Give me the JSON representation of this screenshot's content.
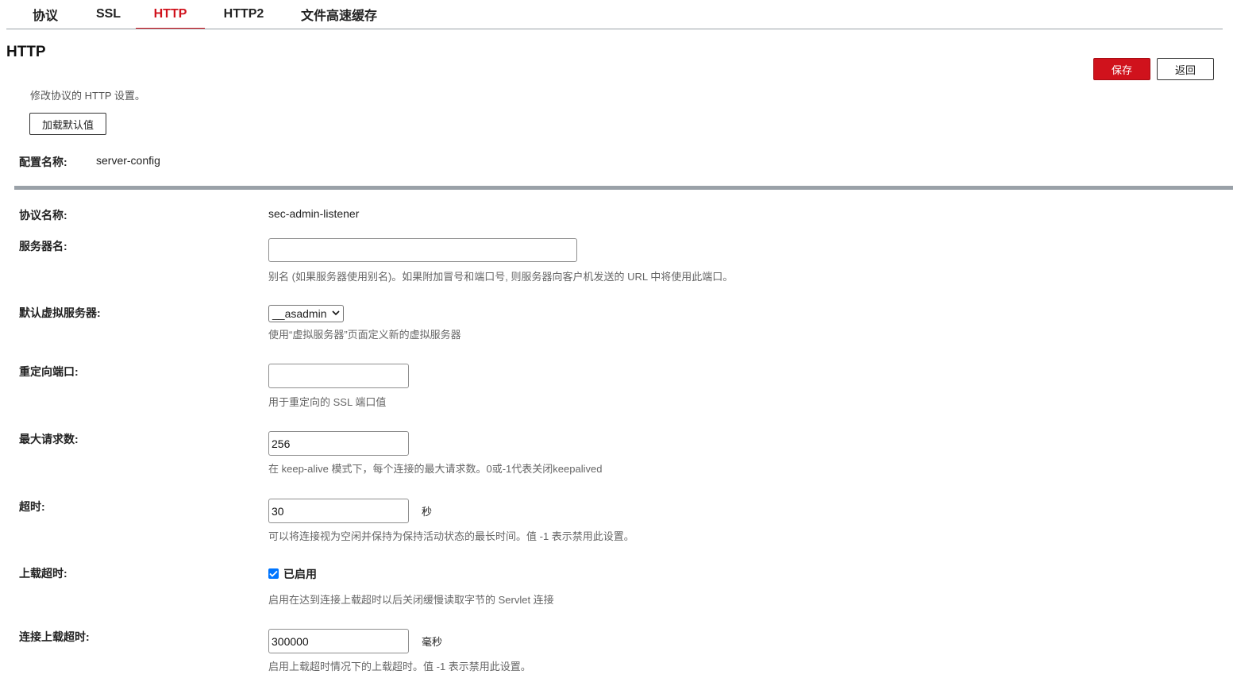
{
  "tabs": [
    {
      "label": "协议"
    },
    {
      "label": "SSL"
    },
    {
      "label": "HTTP"
    },
    {
      "label": "HTTP2"
    },
    {
      "label": "文件高速缓存"
    }
  ],
  "active_tab": "HTTP",
  "page": {
    "title": "HTTP",
    "description": "修改协议的 HTTP 设置。",
    "load_defaults_label": "加载默认值",
    "save_label": "保存",
    "back_label": "返回"
  },
  "config": {
    "label": "配置名称:",
    "value": "server-config"
  },
  "fields": {
    "protocol_name": {
      "label": "协议名称:",
      "value": "sec-admin-listener"
    },
    "server_name": {
      "label": "服务器名:",
      "value": "",
      "help": "别名 (如果服务器使用别名)。如果附加冒号和端口号, 则服务器向客户机发送的 URL 中将使用此端口。"
    },
    "default_virtual_server": {
      "label": "默认虚拟服务器:",
      "selected": "__asadmin",
      "help": "使用“虚拟服务器”页面定义新的虚拟服务器"
    },
    "redirect_port": {
      "label": "重定向端口:",
      "value": "",
      "help": "用于重定向的 SSL 端口值"
    },
    "max_requests": {
      "label": "最大请求数:",
      "value": "256",
      "help": "在 keep-alive 模式下，每个连接的最大请求数。0或-1代表关闭keepalived"
    },
    "timeout": {
      "label": "超时:",
      "value": "30",
      "unit": "秒",
      "help": "可以将连接视为空闲并保持为保持活动状态的最长时间。值 -1 表示禁用此设置。"
    },
    "upload_timeout": {
      "label": "上载超时:",
      "checked": true,
      "check_label": "已启用",
      "help": "启用在达到连接上载超时以后关闭缓慢读取字节的 Servlet 连接"
    },
    "connection_upload_timeout": {
      "label": "连接上载超时:",
      "value": "300000",
      "unit": "毫秒",
      "help": "启用上载超时情况下的上载超时。值 -1 表示禁用此设置。"
    }
  },
  "colors": {
    "accent": "#d0121c",
    "separator": "#9aa1a8",
    "checkbox": "#0075ff"
  }
}
